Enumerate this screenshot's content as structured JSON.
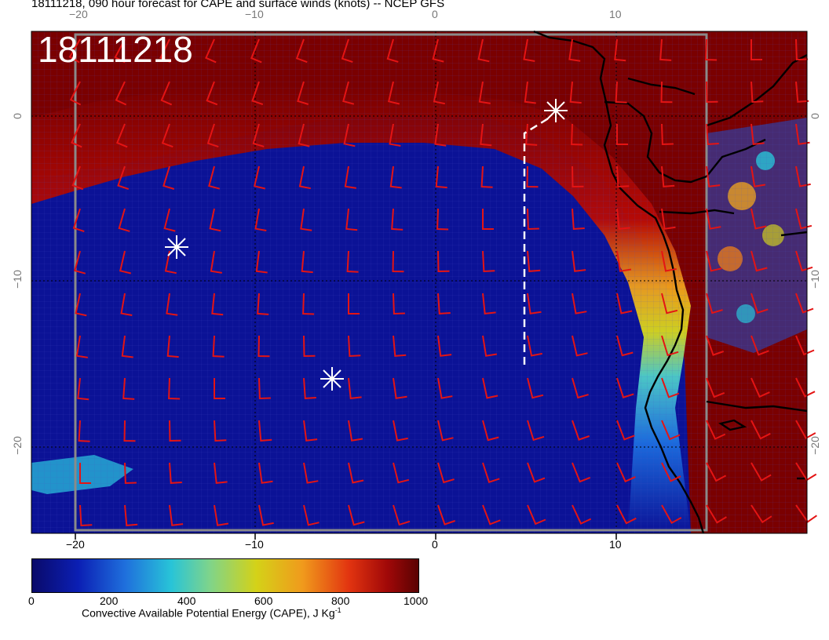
{
  "title": "18111218, 090 hour forecast for CAPE and surface winds (knots) -- NCEP GFS",
  "timestamp": "18111218",
  "ticks": {
    "top": [
      "−20",
      "−10",
      "0",
      "10"
    ],
    "bottom": [
      "−20",
      "−10",
      "0",
      "10"
    ],
    "left": [
      "0",
      "−10",
      "−20"
    ],
    "right": [
      "0",
      "−10",
      "−20"
    ]
  },
  "colorbar": {
    "labels": [
      "0",
      "200",
      "400",
      "600",
      "800",
      "1000"
    ],
    "title": "Convective Available Potential Energy (CAPE), J Kg",
    "title_sup": "-1"
  },
  "colors": {
    "barb": "#e41414",
    "ocean_low": "#0b1296",
    "cape_high": "#7a0000",
    "coast": "#000000",
    "marker": "#ffffff"
  },
  "markers": [
    "asterisk-marker",
    "asterisk-marker",
    "asterisk-marker"
  ]
}
